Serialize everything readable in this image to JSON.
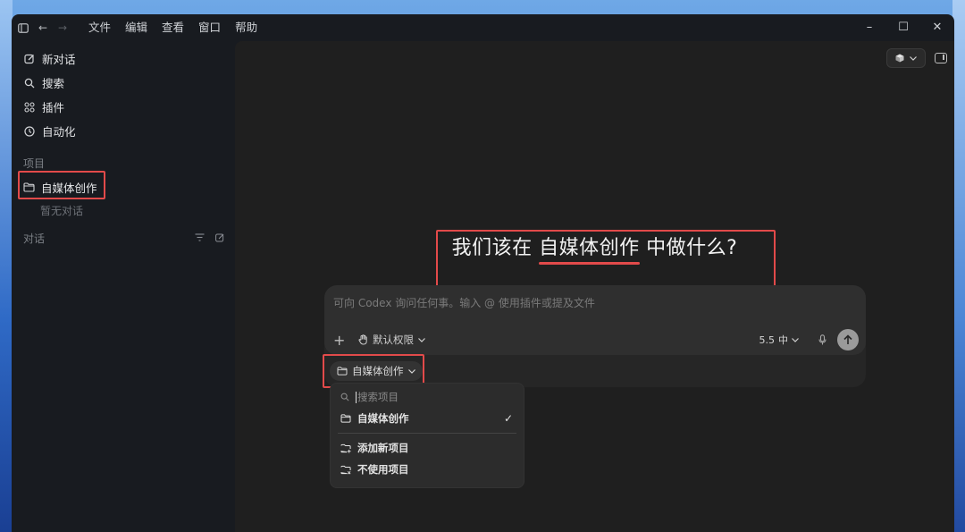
{
  "titlebar": {
    "menu": [
      "文件",
      "编辑",
      "查看",
      "窗口",
      "帮助"
    ],
    "controls": {
      "minimize": "–",
      "maximize": "☐",
      "close": "✕"
    }
  },
  "sidebar": {
    "nav": [
      {
        "label": "新对话",
        "icon": "edit-icon"
      },
      {
        "label": "搜索",
        "icon": "search-icon"
      },
      {
        "label": "插件",
        "icon": "plugins-icon"
      },
      {
        "label": "自动化",
        "icon": "clock-icon"
      }
    ],
    "projects_label": "项目",
    "project": {
      "label": "自媒体创作",
      "icon": "folder-icon"
    },
    "empty_note": "暂无对话",
    "conversations_label": "对话"
  },
  "main": {
    "headline_prefix": "我们该在",
    "headline_highlight": "自媒体创作",
    "headline_suffix": "中做什么?",
    "composer": {
      "placeholder": "可向 Codex 询问任何事。输入 @ 使用插件或提及文件",
      "permissions_label": "默认权限",
      "model_label": "5.5",
      "reasoning_label": "中"
    },
    "project_pill": {
      "label": "自媒体创作"
    },
    "dropdown": {
      "search_placeholder": "搜索项目",
      "current_project": "自媒体创作",
      "add_project": "添加新项目",
      "no_project": "不使用项目"
    }
  },
  "colors": {
    "highlight": "#e24a4a",
    "window_bg": "#181b20",
    "main_bg": "#1f1f1f"
  }
}
